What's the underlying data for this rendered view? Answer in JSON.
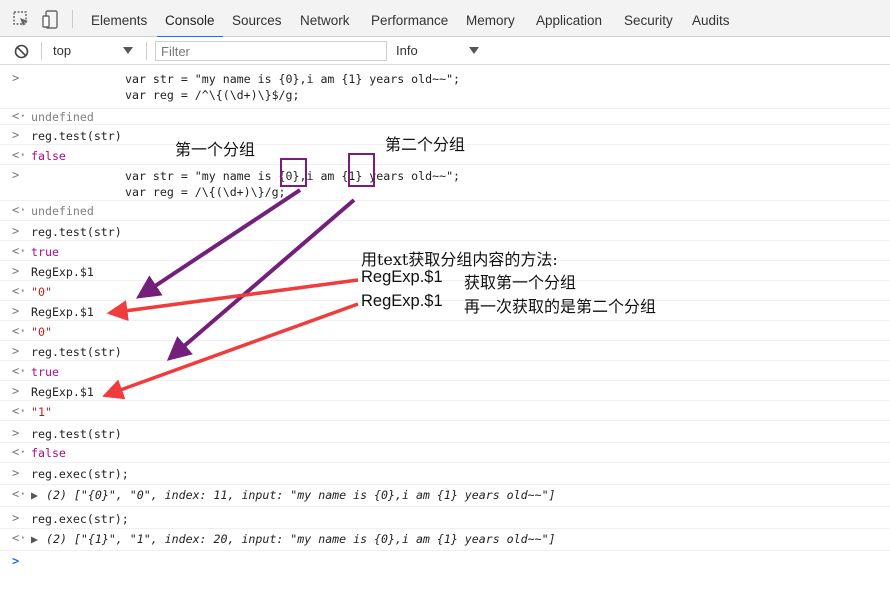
{
  "tabs": [
    "Elements",
    "Console",
    "Sources",
    "Network",
    "Performance",
    "Memory",
    "Application",
    "Security",
    "Audits"
  ],
  "active_tab": "Console",
  "filterbar": {
    "context": "top",
    "filter_placeholder": "Filter",
    "level": "Info"
  },
  "console": {
    "var_str_1": "var str = \"my name is {0},i am {1} years old~~\";",
    "var_reg_1": "var reg = /^\\{(\\d+)\\}$/g;",
    "undefined_1": "undefined",
    "test_1": "reg.test(str)",
    "false_1": "false",
    "var_str_2": "var str = \"my name is {0},i am {1} years old~~\";",
    "var_reg_2": "var reg = /\\{(\\d+)\\}/g;",
    "undefined_2": "undefined",
    "test_2": "reg.test(str)",
    "true_2": "true",
    "regexp_1a": "RegExp.$1",
    "val_1a": "\"0\"",
    "regexp_1b": "RegExp.$1",
    "val_1b": "\"0\"",
    "test_3": "reg.test(str)",
    "true_3": "true",
    "regexp_1c": "RegExp.$1",
    "val_1c": "\"1\"",
    "test_4": "reg.test(str)",
    "false_4": "false",
    "exec_1": "reg.exec(str);",
    "exec_res_1": "(2) [\"{0}\", \"0\", index: 11, input: \"my name is {0},i am {1} years old~~\"]",
    "exec_2": "reg.exec(str);",
    "exec_res_2": "(2) [\"{1}\", \"1\", index: 20, input: \"my name is {0},i am {1} years old~~\"]"
  },
  "annotations": {
    "group1": "第一个分组",
    "group2": "第二个分组",
    "method_title": "用text获取分组内容的方法:",
    "line1_code": "RegExp.$1",
    "line1_text": "获取第一个分组",
    "line2_code": "RegExp.$1",
    "line2_text": "再一次获取的是第二个分组"
  },
  "colors": {
    "purple_arrow": "#741f7a",
    "red_arrow": "#f03c3c",
    "accent": "#1a73e8"
  }
}
